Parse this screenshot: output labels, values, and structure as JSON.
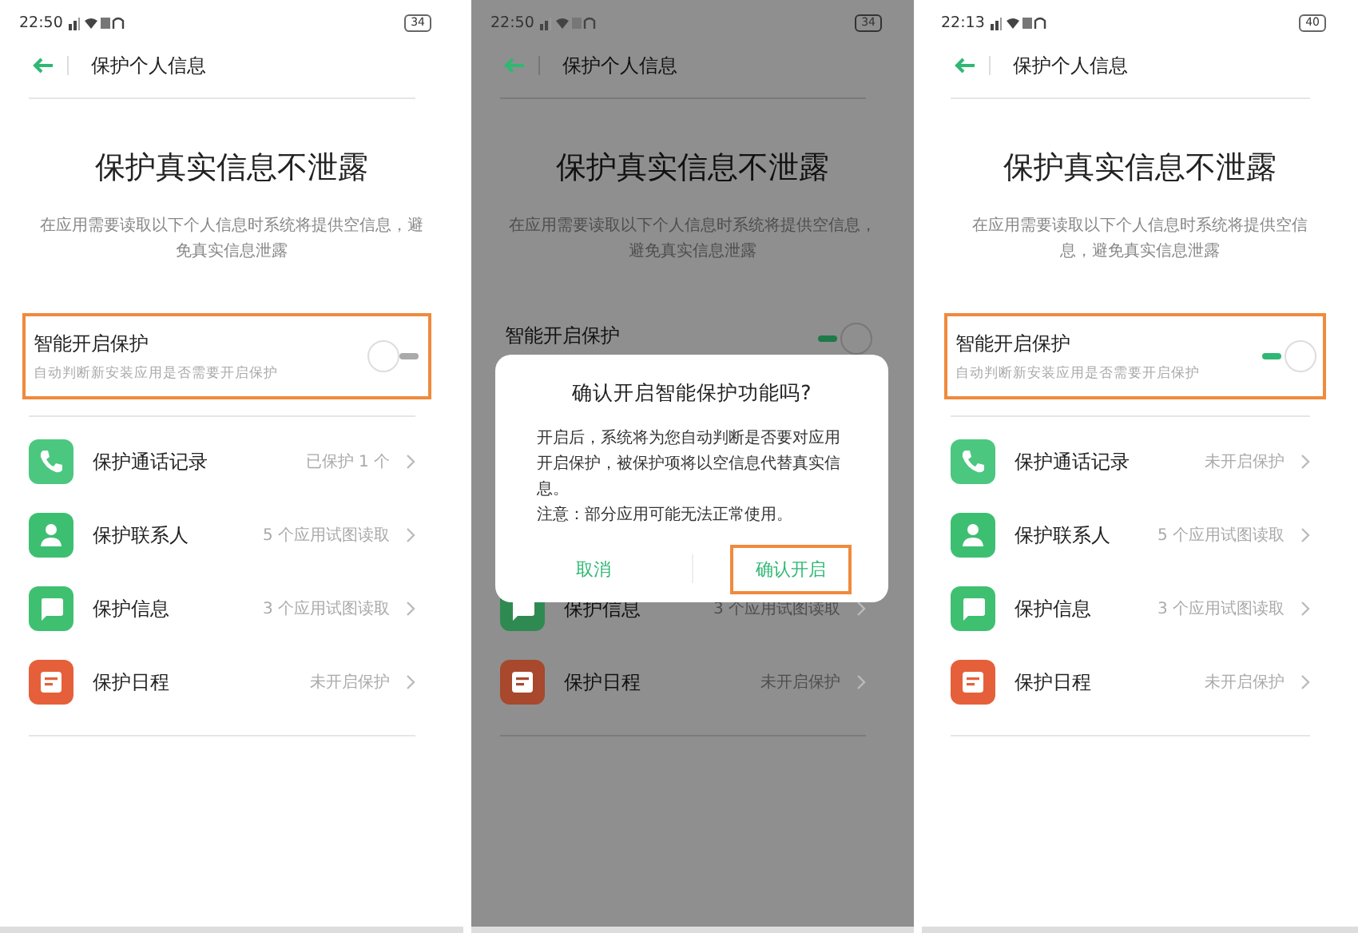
{
  "screens": [
    {
      "status": {
        "time": "22:50",
        "battery": "34"
      },
      "header": {
        "title": "保护个人信息"
      },
      "hero": {
        "title": "保护真实信息不泄露",
        "description": "在应用需要读取以下个人信息时系统将提供空信息，避免真实信息泄露"
      },
      "smart_protection": {
        "title": "智能开启保护",
        "subtitle": "自动判断新安装应用是否需要开启保护",
        "on": false,
        "highlighted": true
      },
      "rows": [
        {
          "kind": "phone",
          "color": "#4cc77f",
          "label": "保护通话记录",
          "status": "已保护 1 个"
        },
        {
          "kind": "contact",
          "color": "#3dbf72",
          "label": "保护联系人",
          "status": "5 个应用试图读取"
        },
        {
          "kind": "message",
          "color": "#3fc070",
          "label": "保护信息",
          "status": "3 个应用试图读取"
        },
        {
          "kind": "calendar",
          "color": "#e5603a",
          "label": "保护日程",
          "status": "未开启保护"
        }
      ]
    },
    {
      "status": {
        "time": "22:50",
        "battery": "34"
      },
      "header": {
        "title": "保护个人信息"
      },
      "hero": {
        "title": "保护真实信息不泄露",
        "description": "在应用需要读取以下个人信息时系统将提供空信息，避免真实信息泄露"
      },
      "smart_protection": {
        "title": "智能开启保护",
        "on": true,
        "highlighted": false
      },
      "rows": [
        {
          "kind": "message",
          "color": "#2f8a52",
          "label": "保护信息",
          "status": "3 个应用试图读取"
        },
        {
          "kind": "calendar",
          "color": "#a8482c",
          "label": "保护日程",
          "status": "未开启保护"
        }
      ],
      "dialog": {
        "title": "确认开启智能保护功能吗?",
        "body": [
          "开启后，系统将为您自动判断是否要对应用开启保护，被保护项将以空信息代替真实信息。",
          "注意：部分应用可能无法正常使用。"
        ],
        "buttons": [
          {
            "label": "取消",
            "highlighted": false
          },
          {
            "label": "确认开启",
            "highlighted": true
          }
        ]
      }
    },
    {
      "status": {
        "time": "22:13",
        "battery": "40"
      },
      "header": {
        "title": "保护个人信息"
      },
      "hero": {
        "title": "保护真实信息不泄露",
        "description": "在应用需要读取以下个人信息时系统将提供空信息，避免真实信息泄露"
      },
      "smart_protection": {
        "title": "智能开启保护",
        "subtitle": "自动判断新安装应用是否需要开启保护",
        "on": true,
        "highlighted": true
      },
      "rows": [
        {
          "kind": "phone",
          "color": "#4cc77f",
          "label": "保护通话记录",
          "status": "未开启保护"
        },
        {
          "kind": "contact",
          "color": "#3dbf72",
          "label": "保护联系人",
          "status": "5 个应用试图读取"
        },
        {
          "kind": "message",
          "color": "#3fc070",
          "label": "保护信息",
          "status": "3 个应用试图读取"
        },
        {
          "kind": "calendar",
          "color": "#e5603a",
          "label": "保护日程",
          "status": "未开启保护"
        }
      ]
    }
  ]
}
